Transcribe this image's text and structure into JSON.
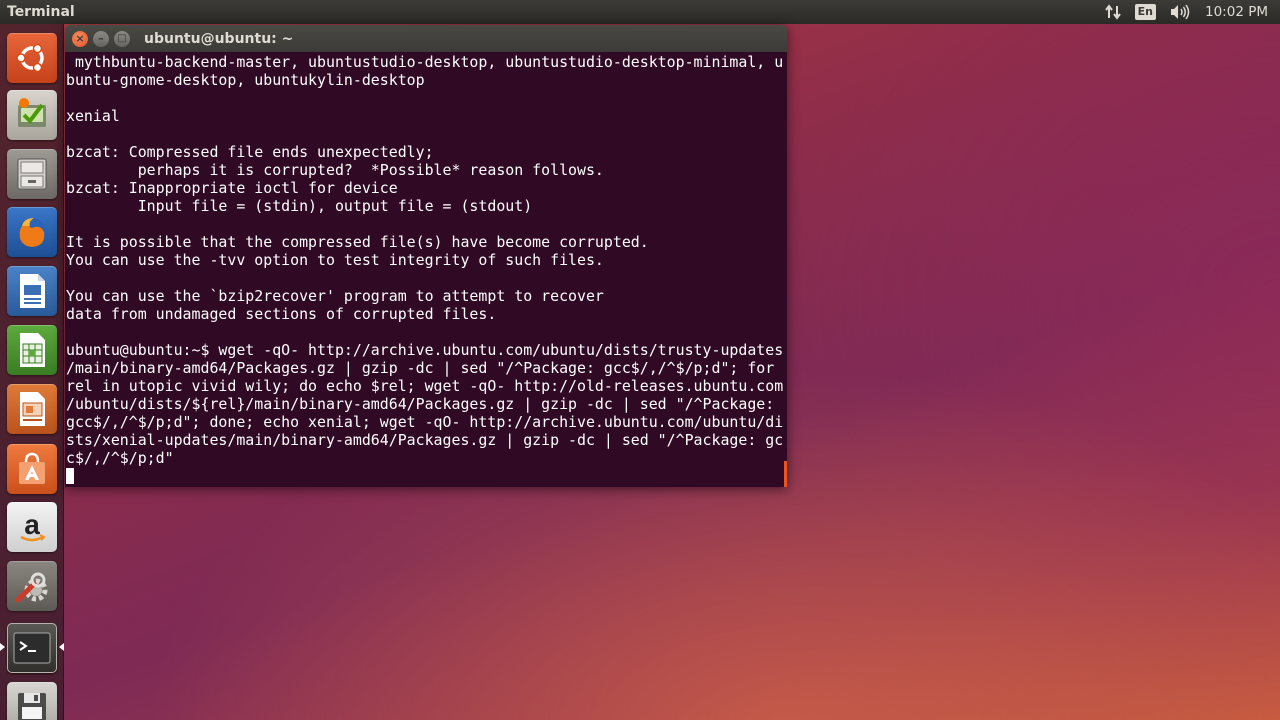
{
  "top_panel": {
    "app_title": "Terminal",
    "keyboard_layout": "En",
    "clock": "10:02 PM",
    "icons": [
      "network-transfer-icon",
      "keyboard-layout-icon",
      "volume-icon"
    ]
  },
  "launcher": {
    "items": [
      {
        "name": "ubuntu-dash",
        "icon": "ubuntu-logo-icon"
      },
      {
        "name": "software-updater",
        "icon": "software-updater-icon"
      },
      {
        "name": "files",
        "icon": "file-cabinet-icon"
      },
      {
        "name": "firefox",
        "icon": "firefox-icon"
      },
      {
        "name": "libreoffice-writer",
        "icon": "writer-document-icon"
      },
      {
        "name": "libreoffice-calc",
        "icon": "calc-spreadsheet-icon"
      },
      {
        "name": "libreoffice-impress",
        "icon": "impress-presentation-icon"
      },
      {
        "name": "ubuntu-software-center",
        "icon": "shopping-bag-icon"
      },
      {
        "name": "amazon",
        "icon": "amazon-icon"
      },
      {
        "name": "system-settings",
        "icon": "wrench-gear-icon"
      },
      {
        "name": "terminal",
        "icon": "terminal-icon",
        "active": true
      },
      {
        "name": "save-device",
        "icon": "floppy-disk-icon"
      }
    ]
  },
  "terminal": {
    "window_title": "ubuntu@ubuntu: ~",
    "close_label": "×",
    "minimize_label": "–",
    "maximize_label": "□",
    "lines": [
      " mythbuntu-backend-master, ubuntustudio-desktop, ubuntustudio-desktop-minimal, u",
      "buntu-gnome-desktop, ubuntukylin-desktop",
      "",
      "xenial",
      "",
      "bzcat: Compressed file ends unexpectedly;",
      "        perhaps it is corrupted?  *Possible* reason follows.",
      "bzcat: Inappropriate ioctl for device",
      "        Input file = (stdin), output file = (stdout)",
      "",
      "It is possible that the compressed file(s) have become corrupted.",
      "You can use the -tvv option to test integrity of such files.",
      "",
      "You can use the `bzip2recover' program to attempt to recover",
      "data from undamaged sections of corrupted files.",
      "",
      "ubuntu@ubuntu:~$ wget -qO- http://archive.ubuntu.com/ubuntu/dists/trusty-updates",
      "/main/binary-amd64/Packages.gz | gzip -dc | sed \"/^Package: gcc$/,/^$/p;d\"; for",
      "rel in utopic vivid wily; do echo $rel; wget -qO- http://old-releases.ubuntu.com",
      "/ubuntu/dists/${rel}/main/binary-amd64/Packages.gz | gzip -dc | sed \"/^Package: ",
      "gcc$/,/^$/p;d\"; done; echo xenial; wget -qO- http://archive.ubuntu.com/ubuntu/di",
      "sts/xenial-updates/main/binary-amd64/Packages.gz | gzip -dc | sed \"/^Package: gc",
      "c$/,/^$/p;d\""
    ],
    "colors": {
      "background": "#300a24",
      "foreground": "#ffffff",
      "accent": "#e95420"
    }
  }
}
